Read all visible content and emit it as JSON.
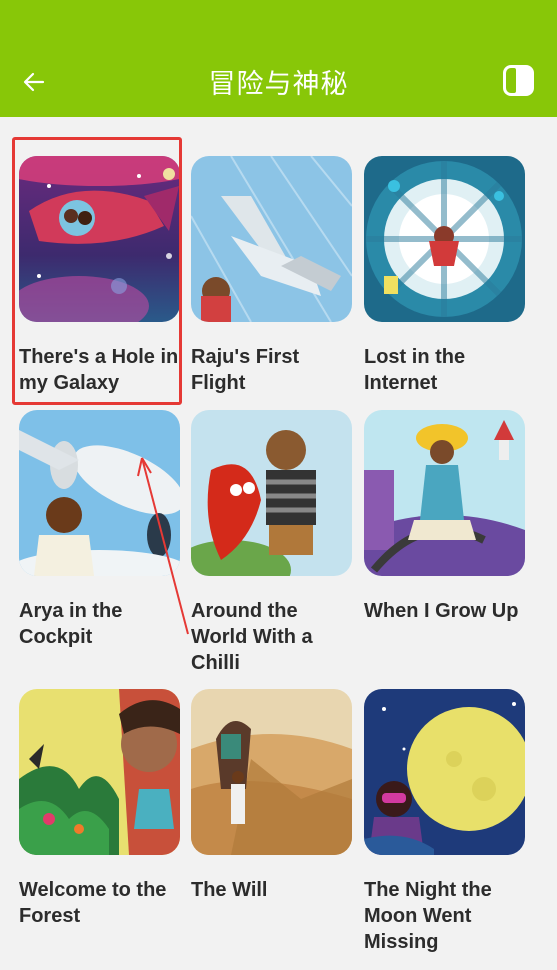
{
  "header": {
    "title": "冒险与神秘",
    "back_icon": "arrow-left-icon",
    "mode_icon": "toggle-icon",
    "background": "#88c708"
  },
  "books": [
    {
      "title": "There's a Hole in my Galaxy",
      "selected": true
    },
    {
      "title": "Raju's First Flight"
    },
    {
      "title": "Lost in the Internet"
    },
    {
      "title": "Arya in the Cockpit"
    },
    {
      "title": "Around the World With a Chilli"
    },
    {
      "title": "When I Grow Up"
    },
    {
      "title": "Welcome to the Forest"
    },
    {
      "title": "The Will"
    },
    {
      "title": "The Night the Moon Went Missing"
    }
  ],
  "annotation": {
    "highlight_color": "#e53935"
  }
}
